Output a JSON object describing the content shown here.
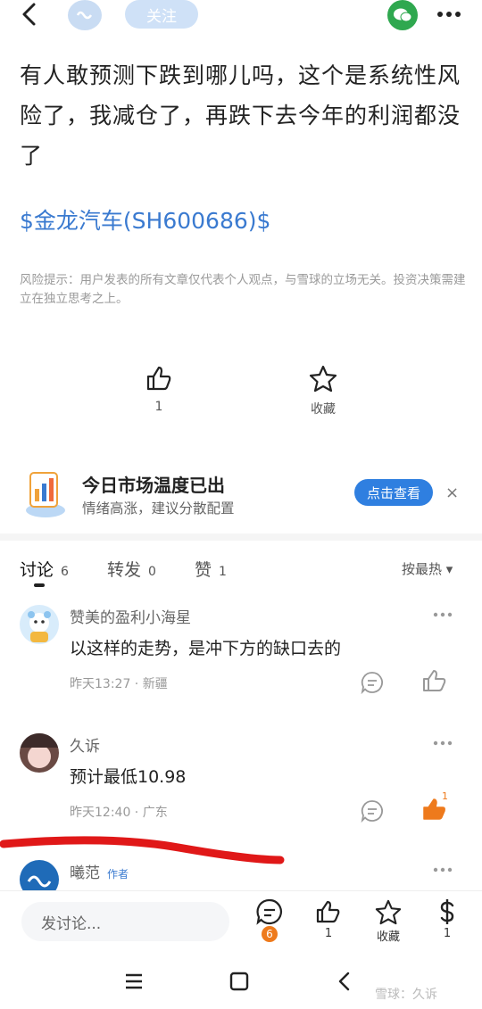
{
  "top_bar": {
    "follow_label": "关注"
  },
  "post": {
    "text": "有人敢预测下跌到哪儿吗，这个是系统性风险了，我减仓了，再跌下去今年的利润都没了",
    "stock_tag": "$金龙汽车(SH600686)$",
    "risk_notice": "风险提示：用户发表的所有文章仅代表个人观点，与雪球的立场无关。投资决策需建立在独立思考之上。",
    "like_count": "1",
    "favorite_label": "收藏"
  },
  "promo": {
    "title": "今日市场温度已出",
    "subtitle": "情绪高涨，建议分散配置",
    "button_label": "点击查看",
    "close_symbol": "×"
  },
  "tabs": [
    {
      "label": "讨论",
      "count": "6"
    },
    {
      "label": "转发",
      "count": "0"
    },
    {
      "label": "赞",
      "count": "1"
    }
  ],
  "sort_label": "按最热 ▾",
  "comments": [
    {
      "name": "赞美的盈利小海星",
      "text": "以这样的走势，是冲下方的缺口去的",
      "meta": "昨天13:27 · 新疆",
      "like_count": ""
    },
    {
      "name": "久诉",
      "text": "预计最低10.98",
      "meta": "昨天12:40 · 广东",
      "like_count": "1"
    },
    {
      "name": "曦范",
      "author_tag": "作者"
    }
  ],
  "bottom_bar": {
    "input_placeholder": "发讨论...",
    "comment_count": "6",
    "like_count": "1",
    "favorite_label": "收藏",
    "reward_count": "1"
  },
  "watermark": "雪球：久诉",
  "colors": {
    "accent": "#2f7fe0",
    "link": "#3a7ad0",
    "orange": "#ee7a1c",
    "wechat": "#2fa84f"
  }
}
